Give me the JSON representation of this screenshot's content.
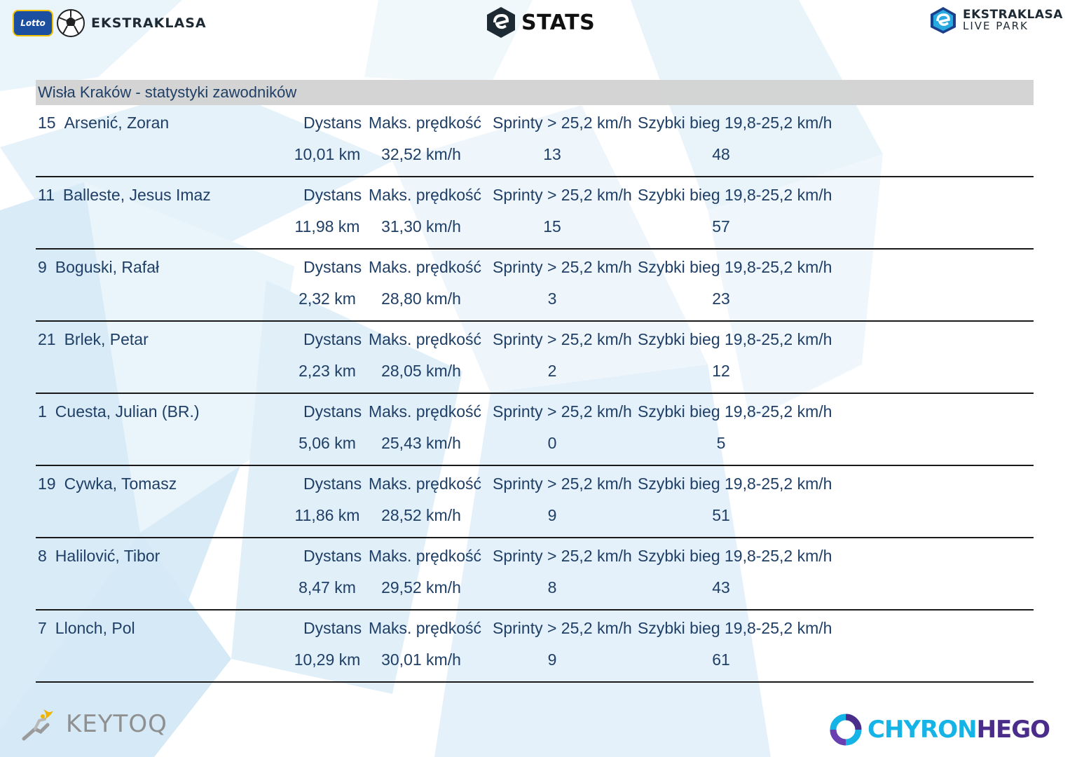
{
  "header": {
    "left_logo": {
      "badge_text": "Lotto",
      "brand": "EKSTRAKLASA",
      "icon": "soccer-ball-icon"
    },
    "center_logo": {
      "text": "STATS",
      "icon": "ekstraklasa-e-icon"
    },
    "right_logo": {
      "line1": "EKSTRAKLASA",
      "line2": "LIVE PARK",
      "icon": "ekstraklasa-e-icon"
    }
  },
  "team_title": "Wisła Kraków - statystyki zawodników",
  "labels": {
    "distance": "Dystans",
    "max_speed": "Maks. prędkość",
    "sprints": "Sprinty > 25,2 km/h",
    "fast_run": "Szybki bieg 19,8-25,2 km/h"
  },
  "players": [
    {
      "number": "15",
      "name": "Arsenić, Zoran",
      "distance": "10,01 km",
      "max_speed": "32,52 km/h",
      "sprints": "13",
      "fast_run": "48"
    },
    {
      "number": "11",
      "name": "Balleste, Jesus Imaz",
      "distance": "11,98 km",
      "max_speed": "31,30 km/h",
      "sprints": "15",
      "fast_run": "57"
    },
    {
      "number": "9",
      "name": "Boguski, Rafał",
      "distance": "2,32 km",
      "max_speed": "28,80 km/h",
      "sprints": "3",
      "fast_run": "23"
    },
    {
      "number": "21",
      "name": "Brlek, Petar",
      "distance": "2,23 km",
      "max_speed": "28,05 km/h",
      "sprints": "2",
      "fast_run": "12"
    },
    {
      "number": "1",
      "name": "Cuesta, Julian (BR.)",
      "distance": "5,06 km",
      "max_speed": "25,43 km/h",
      "sprints": "0",
      "fast_run": "5"
    },
    {
      "number": "19",
      "name": "Cywka, Tomasz",
      "distance": "11,86 km",
      "max_speed": "28,52 km/h",
      "sprints": "9",
      "fast_run": "51"
    },
    {
      "number": "8",
      "name": "Halilović, Tibor",
      "distance": "8,47 km",
      "max_speed": "29,52 km/h",
      "sprints": "8",
      "fast_run": "43"
    },
    {
      "number": "7",
      "name": "Llonch, Pol",
      "distance": "10,29 km",
      "max_speed": "30,01 km/h",
      "sprints": "9",
      "fast_run": "61"
    }
  ],
  "footer": {
    "left_logo": {
      "text": "KEYTOQ",
      "icon": "keytoq-figure-icon"
    },
    "right_logo": {
      "text_part1": "CHYRON",
      "text_part2": "HEGO",
      "icon": "chyronhego-ring-icon"
    }
  },
  "colors": {
    "text": "#1f3f66",
    "header_bar": "#d2d2d2",
    "divider": "#1a1a1a",
    "background_shapes": "#e3f1fa"
  }
}
